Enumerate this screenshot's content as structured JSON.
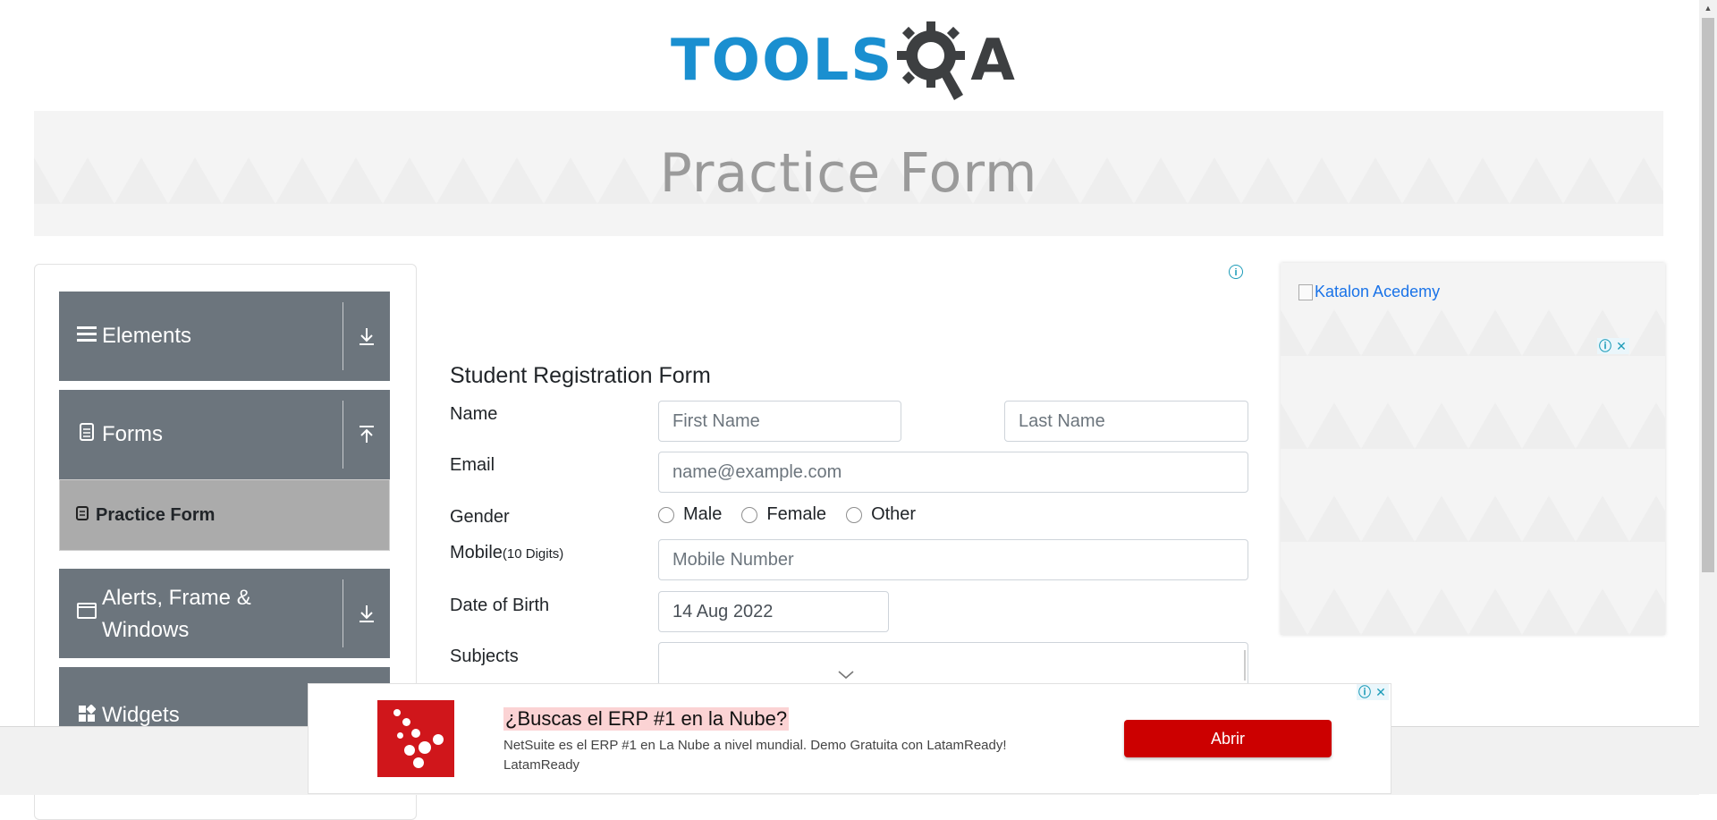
{
  "logo": {
    "part1": "TOOLS",
    "part2": "A",
    "icon": "gear-magnifier-icon"
  },
  "banner": {
    "title": "Practice Form"
  },
  "sidebar": {
    "groups": [
      {
        "label": "Elements",
        "icon": "hamburger-icon",
        "arrow": "download-arrow-icon"
      },
      {
        "label": "Forms",
        "icon": "document-icon",
        "arrow": "upload-arrow-icon"
      },
      {
        "label": "Alerts, Frame & Windows",
        "icon": "window-icon",
        "arrow": "download-arrow-icon"
      },
      {
        "label": "Widgets",
        "icon": "widgets-icon",
        "arrow": "download-arrow-icon"
      }
    ],
    "active_item": {
      "label": "Practice Form",
      "icon": "form-icon"
    }
  },
  "form": {
    "title": "Student Registration Form",
    "name_label": "Name",
    "first_name_placeholder": "First Name",
    "last_name_placeholder": "Last Name",
    "email_label": "Email",
    "email_placeholder": "name@example.com",
    "gender_label": "Gender",
    "gender_options": [
      "Male",
      "Female",
      "Other"
    ],
    "mobile_label": "Mobile",
    "mobile_hint": "(10 Digits)",
    "mobile_placeholder": "Mobile Number",
    "dob_label": "Date of Birth",
    "dob_value": "14 Aug 2022",
    "subjects_label": "Subjects"
  },
  "side_ad": {
    "image_alt": "Katalon Acedemy"
  },
  "bottom_ad": {
    "headline": "¿Buscas el ERP #1 en la Nube?",
    "description": "NetSuite es el ERP #1 en La Nube a nivel mundial. Demo Gratuita con LatamReady! LatamReady",
    "button": "Abrir"
  },
  "colors": {
    "accent_blue": "#1a8fd0",
    "sidebar_gray": "#6c757d",
    "active_item_gray": "#ababab",
    "ad_red": "#cc0000"
  }
}
